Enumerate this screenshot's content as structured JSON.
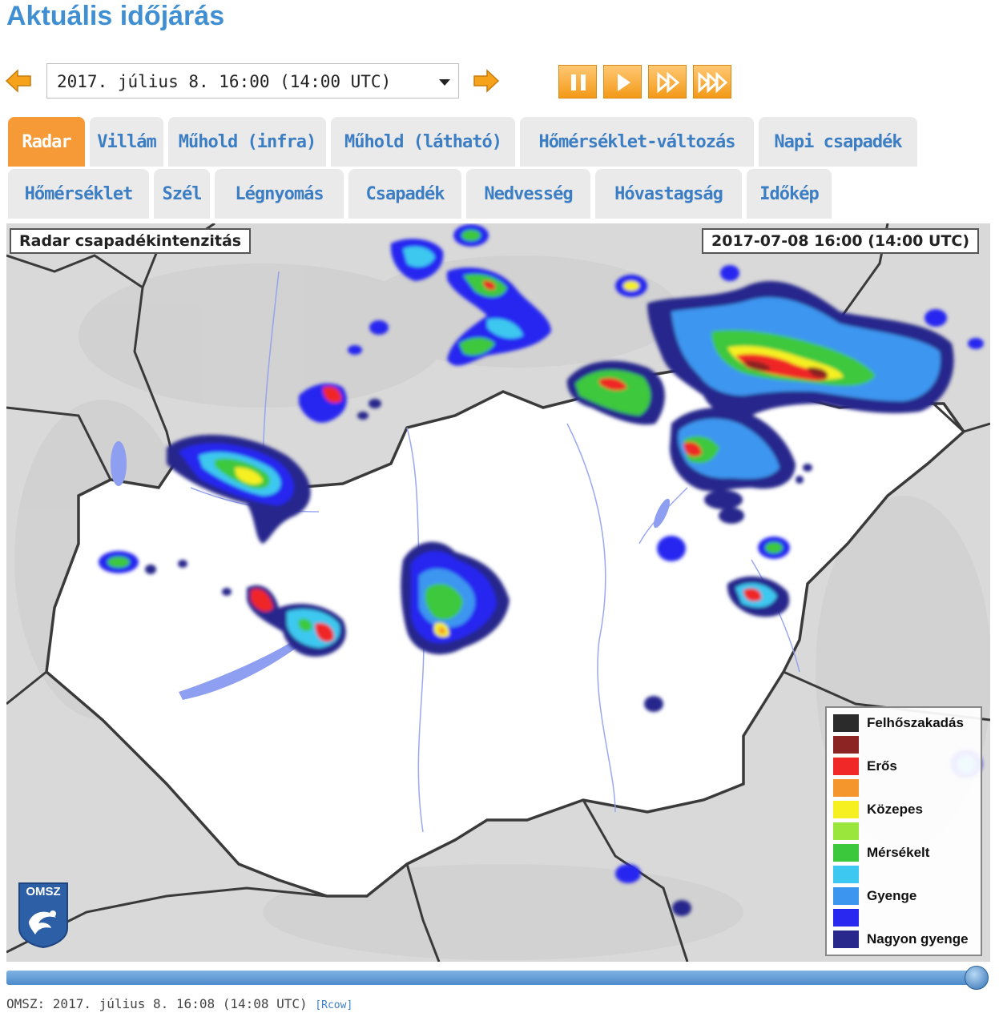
{
  "header": {
    "title": "Aktuális időjárás"
  },
  "timeline": {
    "selected": "2017. július 8. 16:00 (14:00  UTC)"
  },
  "tabs_row1": [
    "Radar",
    "Villám",
    "Műhold (infra)",
    "Műhold (látható)",
    "Hőmérséklet-változás",
    "Napi csapadék"
  ],
  "tabs_row2": [
    "Hőmérséklet",
    "Szél",
    "Légnyomás",
    "Csapadék",
    "Nedvesség",
    "Hóvastagság",
    "Időkép"
  ],
  "active_tab": "Radar",
  "map": {
    "title": "Radar csapadékintenzitás",
    "timestamp": "2017-07-08 16:00 (14:00 UTC)",
    "logo_text": "OMSZ"
  },
  "legend": [
    {
      "label": "Felhőszakadás",
      "color": "#2b2b2b"
    },
    {
      "label": "",
      "color": "#8c2424"
    },
    {
      "label": "Erős",
      "color": "#f02828"
    },
    {
      "label": "",
      "color": "#f5962d"
    },
    {
      "label": "Közepes",
      "color": "#f6f020"
    },
    {
      "label": "",
      "color": "#9ae63c"
    },
    {
      "label": "Mérsékelt",
      "color": "#3cc83c"
    },
    {
      "label": "",
      "color": "#3cc8f0"
    },
    {
      "label": "Gyenge",
      "color": "#3c96f0"
    },
    {
      "label": "",
      "color": "#2828f0"
    },
    {
      "label": "Nagyon gyenge",
      "color": "#28288c"
    }
  ],
  "slider": {
    "position": 1.0
  },
  "footer": {
    "text": "OMSZ: 2017. július 8. 16:08 (14:08  UTC)",
    "link": "[Rcow]"
  },
  "colors": {
    "accent": "#3f8fd2",
    "tab_active": "#f69a38",
    "control": "#f39a18"
  }
}
